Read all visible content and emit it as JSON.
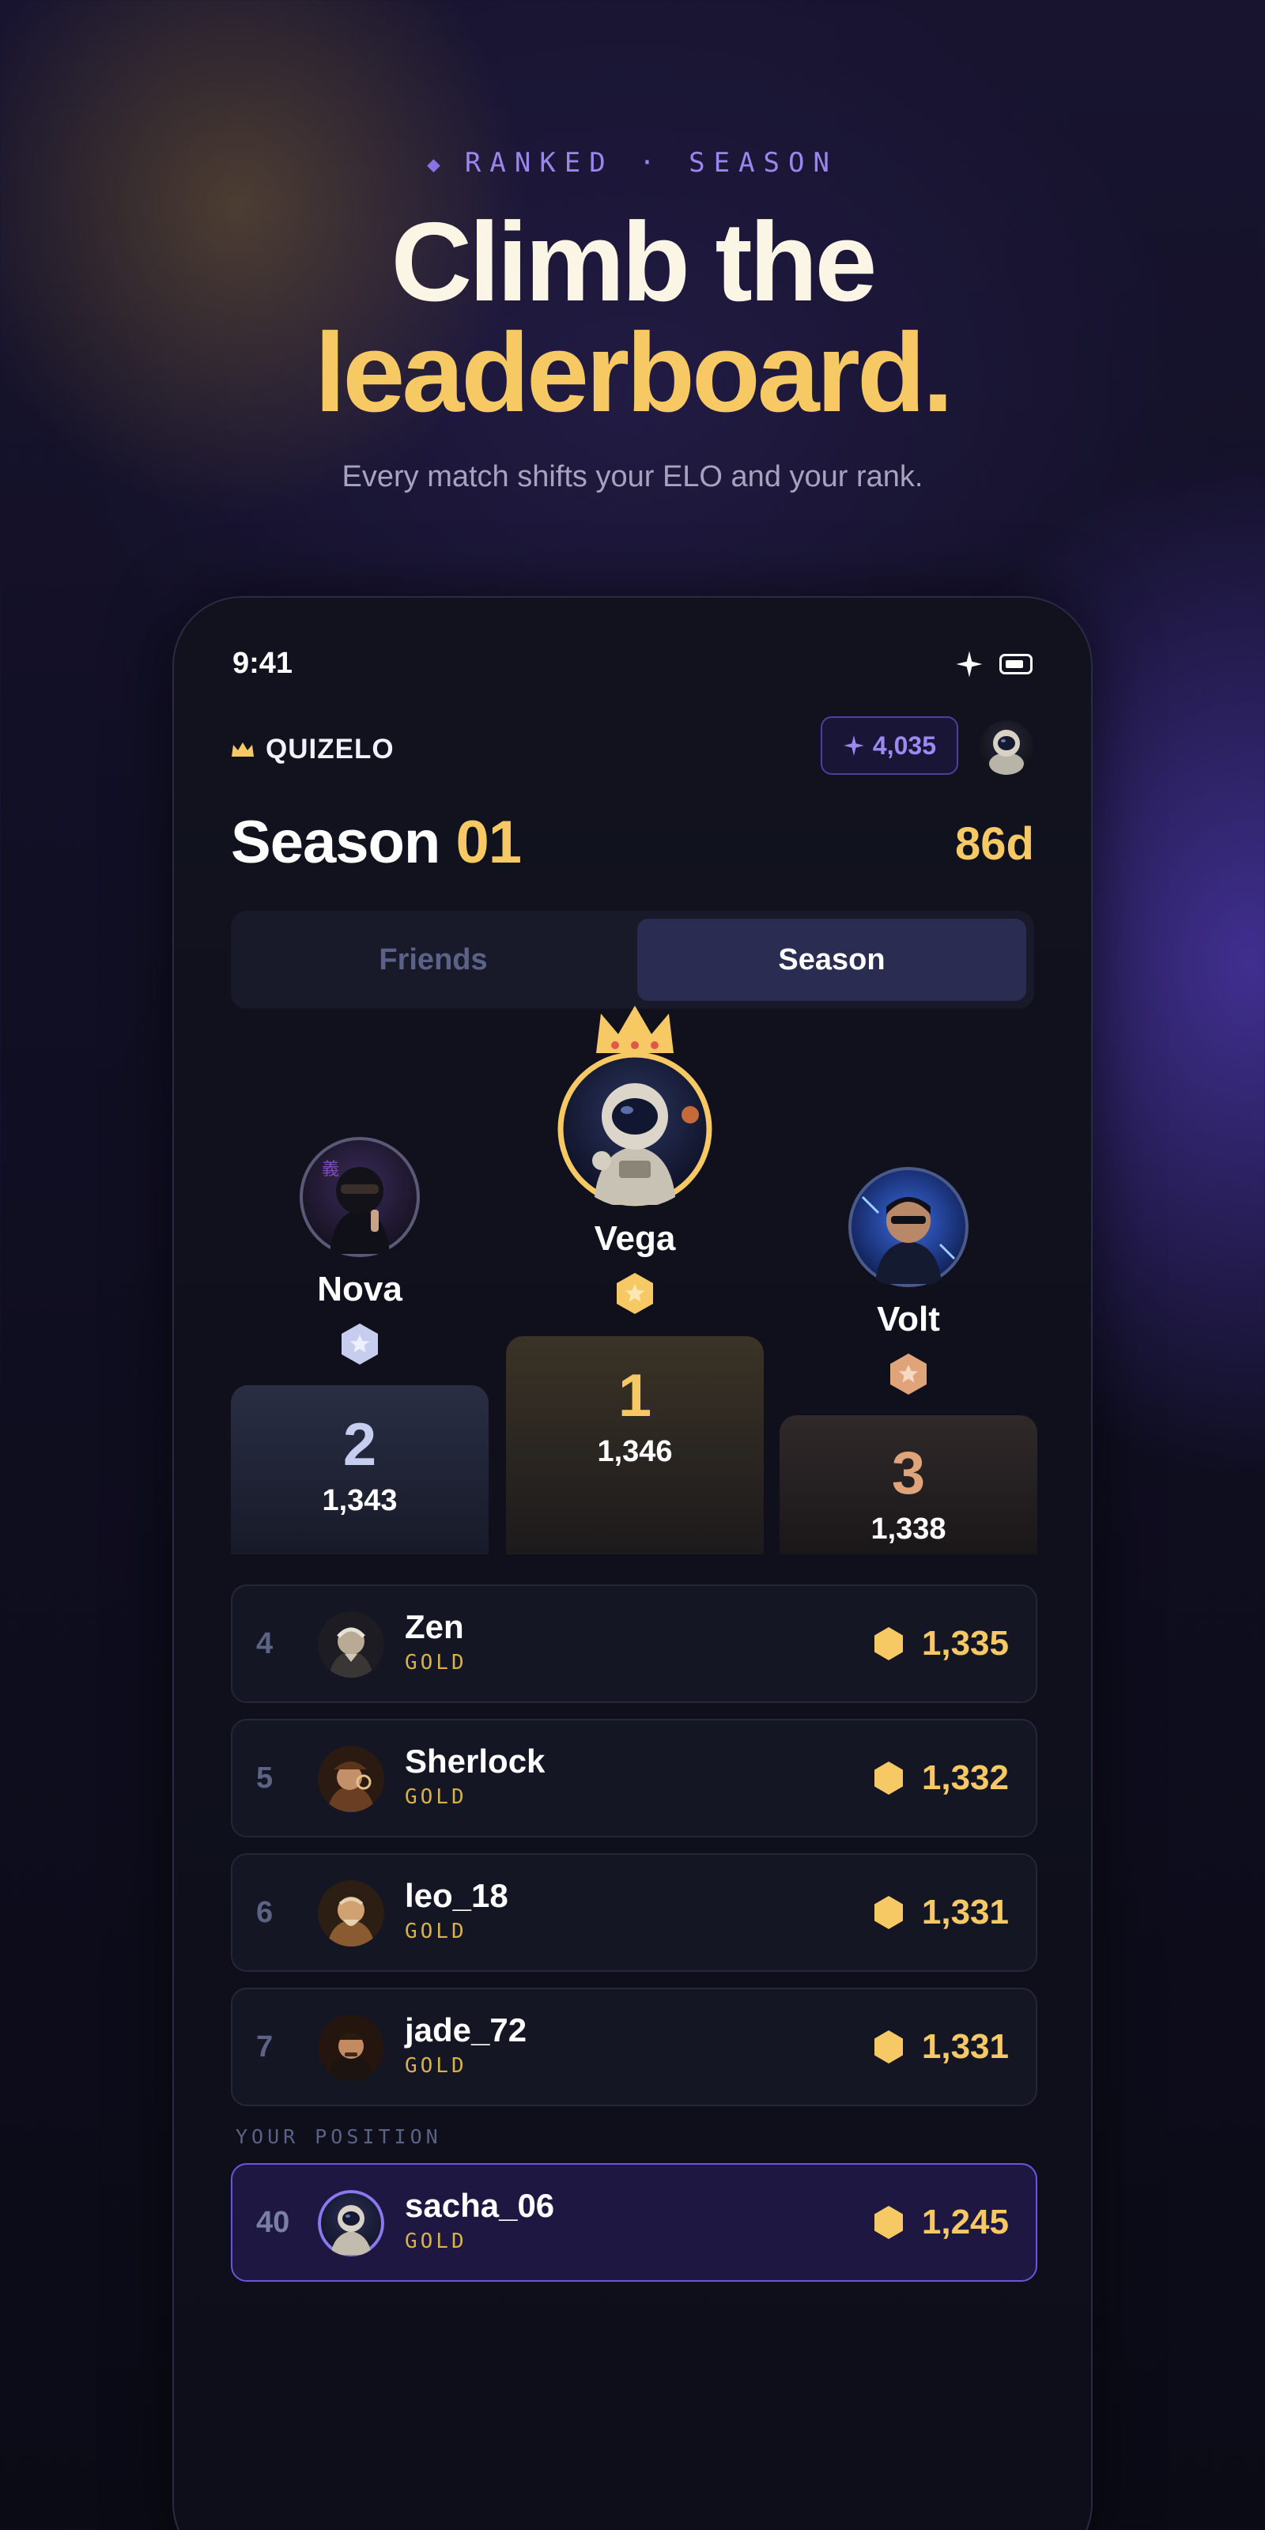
{
  "hero": {
    "eyebrow": "RANKED · SEASON",
    "title_line1": "Climb the",
    "title_line2": "leaderboard.",
    "subtitle": "Every match shifts your ELO and your rank."
  },
  "status_bar": {
    "time": "9:41"
  },
  "app": {
    "brand": "QUIZELO",
    "points": "4,035",
    "season_label": "Season",
    "season_number": "01",
    "days_left": "86d"
  },
  "tabs": [
    {
      "label": "Friends",
      "active": false
    },
    {
      "label": "Season",
      "active": true
    }
  ],
  "podium": {
    "first": {
      "rank": "1",
      "name": "Vega",
      "score": "1,346"
    },
    "second": {
      "rank": "2",
      "name": "Nova",
      "score": "1,343"
    },
    "third": {
      "rank": "3",
      "name": "Volt",
      "score": "1,338"
    }
  },
  "leaderboard": [
    {
      "rank": "4",
      "name": "Zen",
      "tier": "GOLD",
      "score": "1,335"
    },
    {
      "rank": "5",
      "name": "Sherlock",
      "tier": "GOLD",
      "score": "1,332"
    },
    {
      "rank": "6",
      "name": "leo_18",
      "tier": "GOLD",
      "score": "1,331"
    },
    {
      "rank": "7",
      "name": "jade_72",
      "tier": "GOLD",
      "score": "1,331"
    }
  ],
  "your_position": {
    "label": "YOUR POSITION",
    "rank": "40",
    "name": "sacha_06",
    "tier": "GOLD",
    "score": "1,245"
  },
  "colors": {
    "accent_gold": "#f6c965",
    "accent_purple": "#6b55e0",
    "silver": "#c6cdee",
    "bronze": "#e0a47a"
  },
  "icons": [
    "diamond-icon",
    "sparkle-icon",
    "battery-icon",
    "crown-icon",
    "star-badge-icon",
    "hexagon-coin-icon"
  ]
}
